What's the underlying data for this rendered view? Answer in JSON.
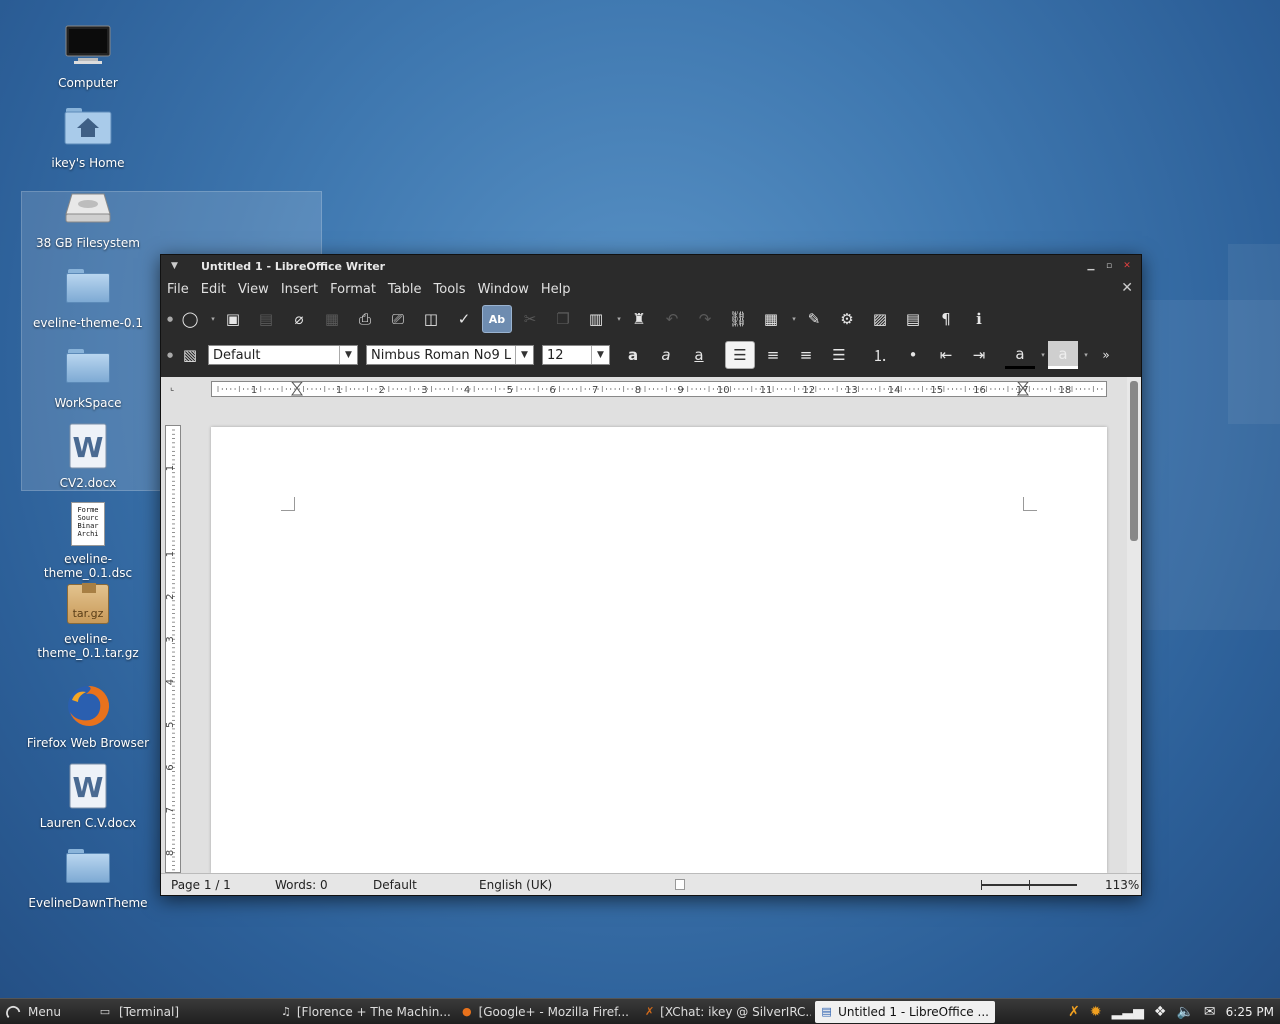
{
  "desktop": {
    "icons": [
      {
        "label": "Computer",
        "icon": "monitor-icon"
      },
      {
        "label": "ikey's Home",
        "icon": "home-folder-icon"
      },
      {
        "label": "38 GB Filesystem",
        "icon": "hard-drive-icon"
      },
      {
        "label": "eveline-theme-0.1",
        "icon": "folder-icon"
      },
      {
        "label": "WorkSpace",
        "icon": "folder-icon"
      },
      {
        "label": "CV2.docx",
        "icon": "word-document-icon"
      },
      {
        "label": "eveline-theme_0.1.dsc",
        "icon": "text-file-icon",
        "preview_text": "Forme Sourc Binar Archi"
      },
      {
        "label": "eveline-theme_0.1.tar.gz",
        "icon": "archive-icon",
        "badge": "tar.gz"
      },
      {
        "label": "Firefox Web Browser",
        "icon": "firefox-icon"
      },
      {
        "label": "Lauren C.V.docx",
        "icon": "word-document-icon"
      },
      {
        "label": "EvelineDawnTheme",
        "icon": "folder-icon"
      }
    ]
  },
  "window": {
    "title": "Untitled 1 - LibreOffice Writer",
    "menu": [
      "File",
      "Edit",
      "View",
      "Insert",
      "Format",
      "Table",
      "Tools",
      "Window",
      "Help"
    ],
    "formatting": {
      "style": "Default",
      "font": "Nimbus Roman No9 L",
      "size": "12",
      "bold_glyph": "a",
      "italic_glyph": "a",
      "underline_glyph": "a",
      "font_color_glyph": "a",
      "highlight_glyph": "a"
    },
    "autospell_label": "Ab",
    "ruler": {
      "h_ticks": [
        "1",
        "1",
        "2",
        "3",
        "4",
        "5",
        "6",
        "7",
        "8",
        "9",
        "10",
        "11",
        "12",
        "13",
        "14",
        "15",
        "16",
        "17",
        "18"
      ],
      "v_ticks": [
        "1",
        "1",
        "2",
        "3",
        "4",
        "5",
        "6",
        "7",
        "8"
      ]
    },
    "status": {
      "page": "Page 1 / 1",
      "words": "Words: 0",
      "style": "Default",
      "language": "English (UK)",
      "zoom": "113%"
    }
  },
  "taskbar": {
    "menu_label": "Menu",
    "tasks": [
      {
        "label": "[Terminal]",
        "icon": "terminal-icon"
      },
      {
        "label": "[Florence + The Machin...",
        "icon": "music-player-icon"
      },
      {
        "label": "[Google+ - Mozilla Firef...",
        "icon": "firefox-icon"
      },
      {
        "label": "[XChat: ikey @ SilverIRC...",
        "icon": "xchat-icon"
      },
      {
        "label": "Untitled 1 - LibreOffice ...",
        "icon": "writer-icon",
        "active": true
      }
    ],
    "clock": "6:25 PM"
  }
}
